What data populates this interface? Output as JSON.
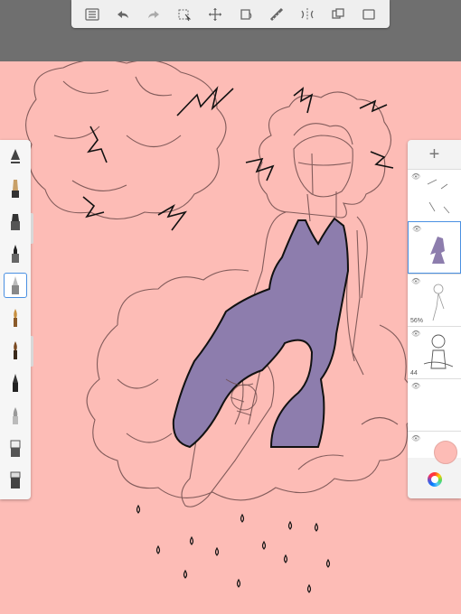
{
  "toolbar": {
    "items": [
      {
        "name": "list-icon"
      },
      {
        "name": "undo-icon"
      },
      {
        "name": "redo-icon"
      },
      {
        "name": "select-icon"
      },
      {
        "name": "transform-icon"
      },
      {
        "name": "fill-icon"
      },
      {
        "name": "ruler-icon"
      },
      {
        "name": "symmetry-icon"
      },
      {
        "name": "layers-style-icon"
      },
      {
        "name": "fullscreen-icon"
      }
    ]
  },
  "colors": {
    "canvas": "#fdbcb6",
    "dress": "#8d7dad",
    "stroke": "#6d4b4b",
    "ink": "#111111",
    "selection": "#4a90e2"
  },
  "brushes": [
    {
      "name": "pencil-brush"
    },
    {
      "name": "marker-brush"
    },
    {
      "name": "inking-brush"
    },
    {
      "name": "pen-brush",
      "selected": true
    },
    {
      "name": "paintbrush-brush"
    },
    {
      "name": "airbrush-brush"
    },
    {
      "name": "ink-pen-brush"
    },
    {
      "name": "smudge-brush"
    },
    {
      "name": "eraser-brush"
    },
    {
      "name": "block-eraser-brush"
    }
  ],
  "layers": {
    "add_label": "+",
    "items": [
      {
        "name": "layer-top",
        "opacity": ""
      },
      {
        "name": "layer-dress",
        "opacity": "",
        "active": true
      },
      {
        "name": "layer-sketch",
        "opacity": "56%"
      },
      {
        "name": "layer-lineart",
        "opacity": "44"
      },
      {
        "name": "layer-empty",
        "opacity": ""
      },
      {
        "name": "layer-background",
        "opacity": ""
      }
    ]
  }
}
